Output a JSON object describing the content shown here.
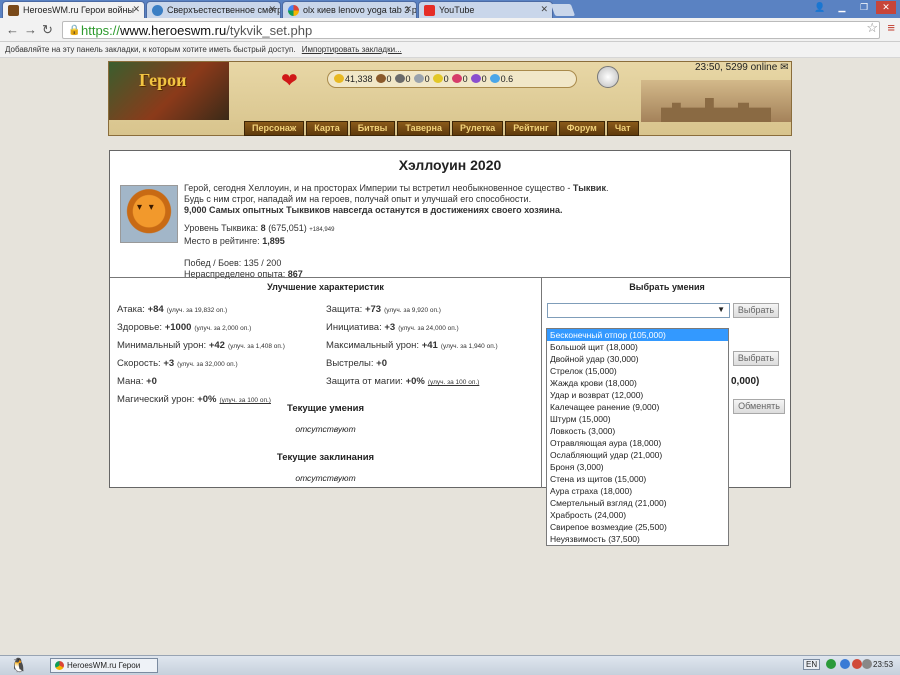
{
  "browser": {
    "tabs": [
      {
        "title": "HeroesWM.ru Герои войны",
        "active": true
      },
      {
        "title": "Сверхъестественное смотр",
        "active": false
      },
      {
        "title": "olx киев lenovo yoga tab 3 p",
        "active": false
      },
      {
        "title": "YouTube",
        "active": false
      }
    ],
    "url": {
      "scheme": "https://",
      "host": "www.heroeswm.ru",
      "path": "/tykvik_set.php"
    },
    "bookmarks_prompt": "Добавляйте на эту панель закладки, к которым хотите иметь быстрый доступ.",
    "bookmarks_import": "Импортировать закладки..."
  },
  "game": {
    "logo_text": "Герои",
    "resources": [
      {
        "icon": "gold-icon",
        "value": "41,338",
        "color": "#e8b923"
      },
      {
        "icon": "wood-icon",
        "value": "0",
        "color": "#8b5a2b"
      },
      {
        "icon": "ore-icon",
        "value": "0",
        "color": "#6b6b6b"
      },
      {
        "icon": "mercury-icon",
        "value": "0",
        "color": "#9aa3ad"
      },
      {
        "icon": "sulfur-icon",
        "value": "0",
        "color": "#e3c828"
      },
      {
        "icon": "crystal-icon",
        "value": "0",
        "color": "#d63c6a"
      },
      {
        "icon": "gems-icon",
        "value": "0",
        "color": "#8a4fcf"
      },
      {
        "icon": "diamond-icon",
        "value": "0.6",
        "color": "#4aa6e8"
      }
    ],
    "time_online": "23:50, 5299 online",
    "nav": [
      "Персонаж",
      "Карта",
      "Битвы",
      "Таверна",
      "Рулетка",
      "Рейтинг",
      "Форум",
      "Чат"
    ]
  },
  "panel": {
    "title": "Хэллоуин 2020",
    "intro_line1": "Герой, сегодня Хеллоуин, и на просторах Империи ты встретил необыкновенное существо - ",
    "intro_creature": "Тыквик",
    "intro_line2": "Будь с ним строг, нападай им на героев, получай опыт и улучшай его способности.",
    "intro_line3": "9,000 Самых опытных Тыквиков навсегда останутся в достижениях своего хозяина.",
    "level_label": "Уровень Тыквика:",
    "level_value": "8",
    "level_exp": "(675,051)",
    "level_gain": "+184,949",
    "rank_label": "Место в рейтинге:",
    "rank_value": "1,895",
    "wins_label": "Побед / Боев: 135 / 200",
    "unspent_label": "Нераспределено опыта:",
    "unspent_value": "867",
    "improve_title": "Улучшение характеристик",
    "stats": [
      {
        "label": "Атака: ",
        "value": "+84",
        "cost": "(улуч. за 19,832 оп.)"
      },
      {
        "label": "Защита: ",
        "value": "+73",
        "cost": "(улуч. за 9,920 оп.)"
      },
      {
        "label": "Здоровье: ",
        "value": "+1000",
        "cost": "(улуч. за 2,000 оп.)"
      },
      {
        "label": "Инициатива: ",
        "value": "+3",
        "cost": "(улуч. за 24,000 оп.)"
      },
      {
        "label": "Минимальный урон: ",
        "value": "+42",
        "cost": "(улуч. за 1,408 оп.)"
      },
      {
        "label": "Максимальный урон: ",
        "value": "+41",
        "cost": "(улуч. за 1,940 оп.)"
      },
      {
        "label": "Скорость: ",
        "value": "+3",
        "cost": "(улуч. за 32,000 оп.)"
      },
      {
        "label": "Выстрелы: ",
        "value": "+0",
        "cost": ""
      },
      {
        "label": "Мана: ",
        "value": "+0",
        "cost": ""
      },
      {
        "label": "Защита от магии: ",
        "value": "+0%",
        "cost": "(улуч. за 100 оп.)"
      },
      {
        "label": "Магический урон: ",
        "value": "+0%",
        "cost": "(улуч. за 100 оп.)"
      }
    ],
    "current_skills_title": "Текущие умения",
    "current_skills_value": "отсутствуют",
    "current_spells_title": "Текущие заклинания",
    "current_spells_value": "отсутствуют",
    "choose_skills_title": "Выбрать умения",
    "choose_button": "Выбрать",
    "choose_button_2": "Выбрать",
    "partial_value": "0,000)",
    "swap_button": "Обменять"
  },
  "dropdown": {
    "options": [
      "Бесконечный отпор (105,000)",
      "Большой щит (18,000)",
      "Двойной удар (30,000)",
      "Стрелок (15,000)",
      "Жажда крови (18,000)",
      "Удар и возврат (12,000)",
      "Калечащее ранение (9,000)",
      "Штурм (15,000)",
      "Ловкость (3,000)",
      "Отравляющая аура (18,000)",
      "Ослабляющий удар (21,000)",
      "Броня (3,000)",
      "Стена из щитов (15,000)",
      "Аура страха (18,000)",
      "Смертельный взгляд (21,000)",
      "Храбрость (24,000)",
      "Свирепое возмездие (25,500)",
      "Неуязвимость (37,500)"
    ],
    "highlighted_index": 0
  },
  "taskbar": {
    "item": "HeroesWM.ru Герои",
    "lang": "EN",
    "time": "23:53"
  }
}
